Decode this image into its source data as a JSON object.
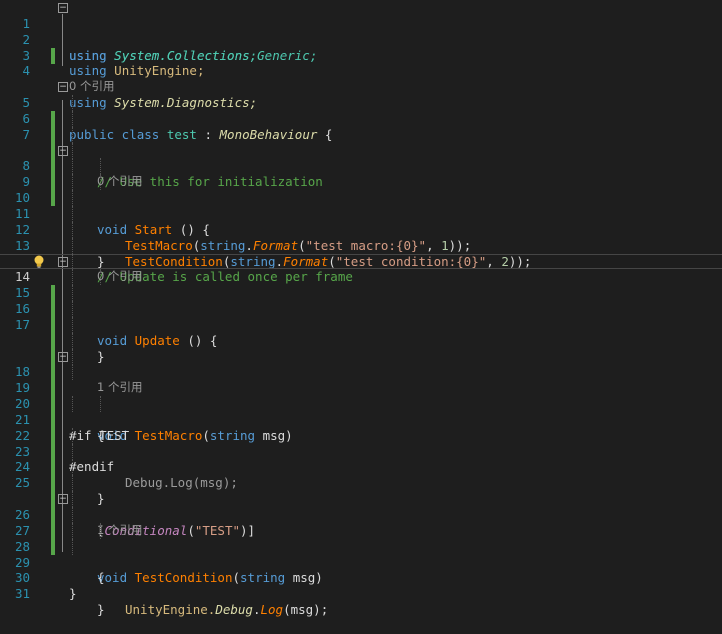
{
  "editor": {
    "line_numbers": [
      "1",
      "2",
      "3",
      "4",
      "5",
      "6",
      "7",
      "8",
      "9",
      "10",
      "11",
      "12",
      "13",
      "14",
      "15",
      "16",
      "17",
      "18",
      "19",
      "20",
      "21",
      "22",
      "23",
      "24",
      "25",
      "26",
      "27",
      "28",
      "29",
      "30",
      "31"
    ],
    "codelens": {
      "class_refs": "0 个引用",
      "start_refs": "0 个引用",
      "update_refs": "0 个引用",
      "testmacro_refs": "1 个引用",
      "testcondition_refs": "1 个引用"
    },
    "code": {
      "l1_kw": "using",
      "l1_ns": " System.Collections;",
      "l2_kw": "using",
      "l2_ns": " System.Collections.Generic;",
      "l3_kw": "using",
      "l3_ns": " UnityEngine;",
      "l4_kw": "using",
      "l4_ns": " System.Diagnostics;",
      "l5_kw": "public class",
      "l5_name": "test",
      "l5_colon": " : ",
      "l5_base": "MonoBehaviour",
      "l5_brace": " {",
      "l7_comment": "// Use this for initialization",
      "l8_kw": "void",
      "l8_name": "Start",
      "l8_rest": " () {",
      "l9_m": "TestMacro",
      "l9_a": "(",
      "l9_b": "string",
      "l9_c": ".",
      "l9_d": "Format",
      "l9_e": "(",
      "l9_s": "\"test macro:{0}\"",
      "l9_f": ", ",
      "l9_n": "1",
      "l9_g": "));",
      "l10_m": "TestCondition",
      "l10_a": "(",
      "l10_b": "string",
      "l10_c": ".",
      "l10_d": "Format",
      "l10_e": "(",
      "l10_s": "\"test condition:{0}\"",
      "l10_f": ", ",
      "l10_n": "2",
      "l10_g": "));",
      "close_brace": "}",
      "open_brace": "{",
      "l13_comment": "// Update is called once per frame",
      "l14_kw": "void",
      "l14_name": "Update",
      "l14_rest": " () {",
      "l18_kw": "void",
      "l18_name": "TestMacro",
      "l18_a": "(",
      "l18_t": "string",
      "l18_b": " msg)",
      "l20_pp": "#if",
      "l20_sym": " TEST",
      "l21_text": "Debug.Log(msg);",
      "l22_pp": "#endif",
      "l25_a": "[",
      "l25_attr": "Conditional",
      "l25_b": "(",
      "l25_s": "\"TEST\"",
      "l25_c": ")]",
      "l26_kw": "void",
      "l26_name": "TestCondition",
      "l26_a": "(",
      "l26_t": "string",
      "l26_b": " msg)",
      "l28_a": "UnityEngine.",
      "l28_b": "Debug",
      "l28_c": ".",
      "l28_d": "Log",
      "l28_e": "(msg);"
    },
    "current_line": "14",
    "colors": {
      "background": "#1e1e1e",
      "line_number": "#2b91af",
      "keyword": "#569cd6",
      "type": "#4ec9b0",
      "comment": "#57a64a",
      "string": "#d69d85",
      "method": "#ff8000",
      "change_bar": "#57a64a"
    }
  }
}
